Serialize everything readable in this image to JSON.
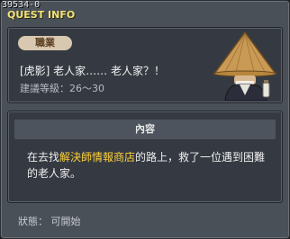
{
  "window": {
    "quest_id": "39534-0",
    "title": "QUEST INFO"
  },
  "quest": {
    "job_label": "職業",
    "name": "[虎影] 老人家…… 老人家？！",
    "level_requirement": "建議等級：26～30",
    "npc_portrait": "straw-hat-old-man"
  },
  "content": {
    "header": "內容",
    "text_before": "在去找",
    "text_highlight": "解決師情報商店",
    "text_after": "的路上，救了一位遇到困難的老人家。"
  },
  "status": {
    "text": "狀態：  可開始"
  },
  "colors": {
    "title": "#f3e27a",
    "highlight": "#ffd23a",
    "badge_bg": "#d9c8b0"
  }
}
